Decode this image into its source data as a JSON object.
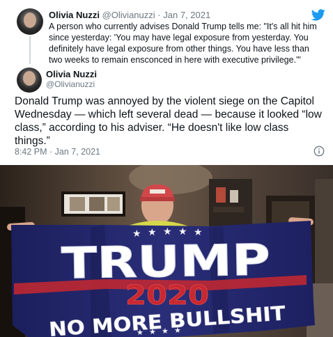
{
  "quoted_tweet": {
    "name": "Olivia Nuzzi",
    "handle": "@Olivianuzzi",
    "separator": "·",
    "date": "Jan 7, 2021",
    "text": "A person who currently advises Donald Trump tells me: \"It's all hit him since yesterday: 'You may have legal exposure from yesterday. You definitely have legal exposure from other things. You have less than two weeks to remain ensconced in here with executive privilege.'\""
  },
  "main_tweet": {
    "name": "Olivia Nuzzi",
    "handle": "@Olivianuzzi",
    "text": "Donald Trump was annoyed by the violent siege on the Capitol Wednesday — which left several dead — because it looked “low class,” according to his adviser. “He doesn't like low class things.”",
    "timestamp": "8:42 PM · Jan 7, 2021"
  },
  "photo": {
    "flag_text_main": "TRUMP",
    "flag_text_year": "2020",
    "flag_text_slogan": "NO MORE BULLSHIT"
  },
  "icons": {
    "brand": "twitter-bird-icon",
    "info": "info-icon",
    "brand_color": "#1d9bf0"
  }
}
